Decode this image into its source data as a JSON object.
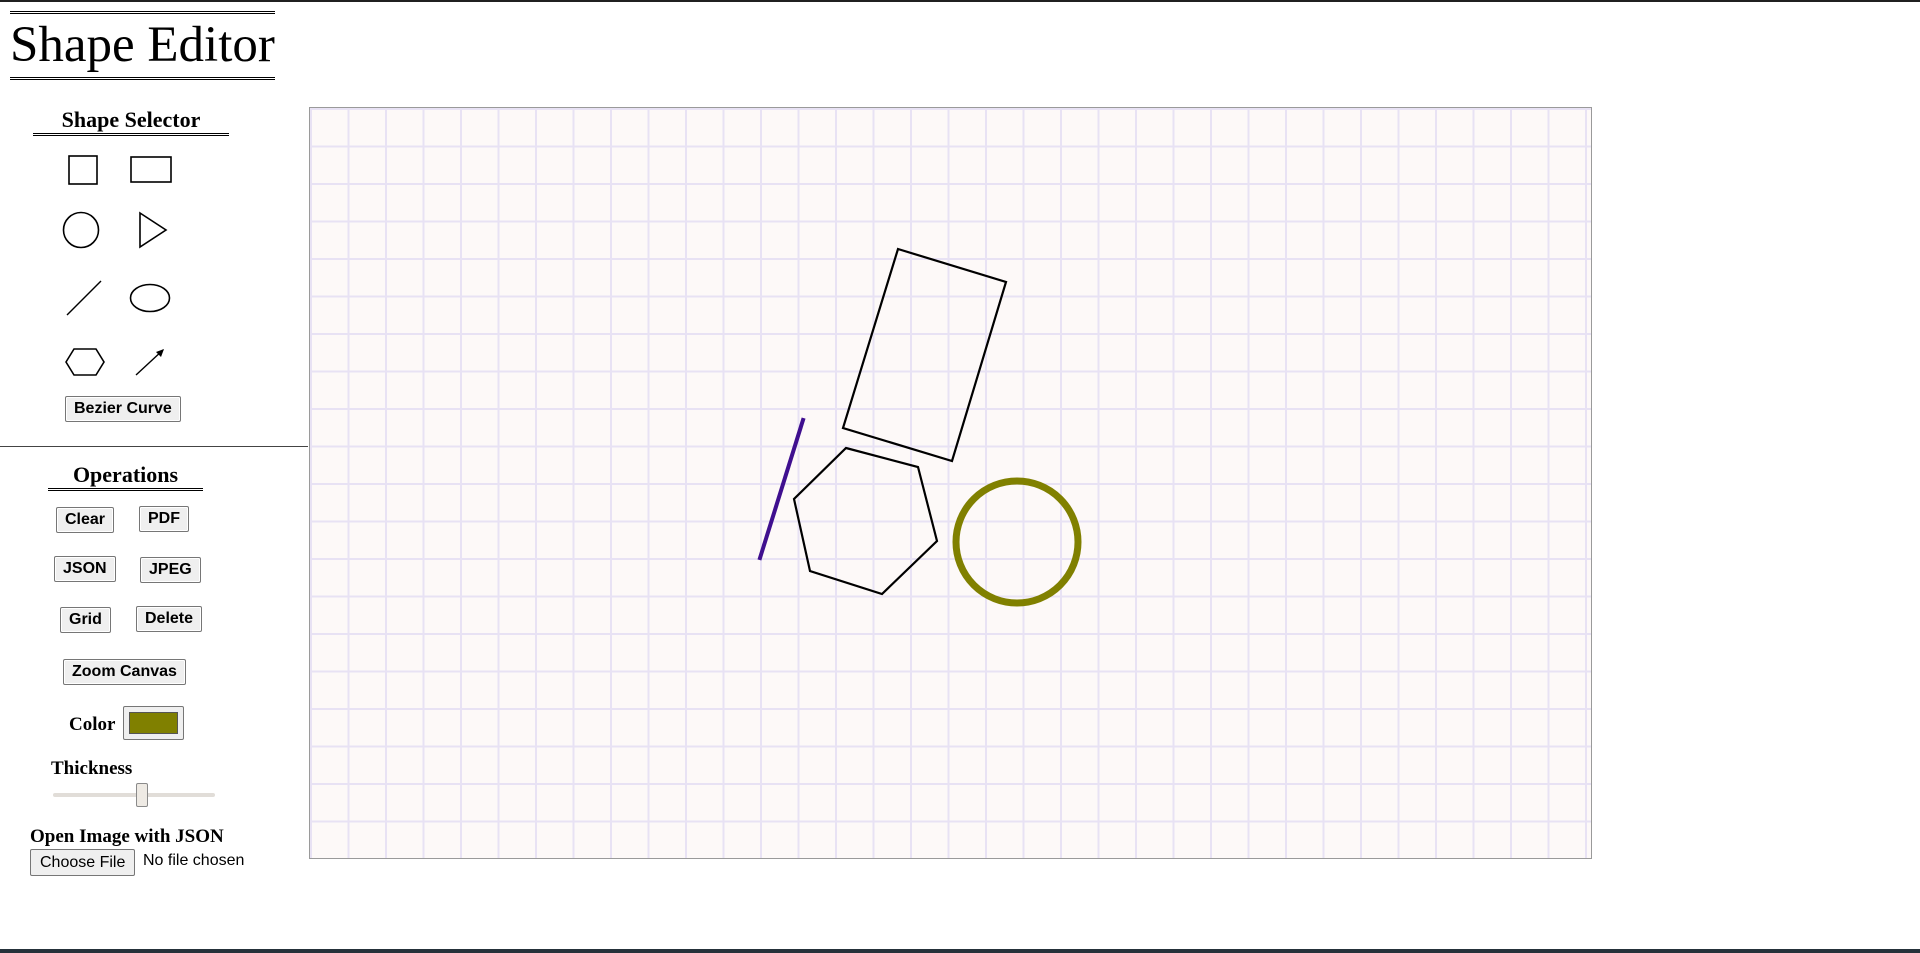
{
  "app": {
    "title": "Shape Editor"
  },
  "shape_selector": {
    "title": "Shape Selector",
    "shapes": [
      {
        "name": "square",
        "icon": "square-icon"
      },
      {
        "name": "rectangle",
        "icon": "rectangle-icon"
      },
      {
        "name": "circle",
        "icon": "circle-icon"
      },
      {
        "name": "triangle",
        "icon": "triangle-icon"
      },
      {
        "name": "line",
        "icon": "line-icon"
      },
      {
        "name": "ellipse",
        "icon": "ellipse-icon"
      },
      {
        "name": "hexagon",
        "icon": "hexagon-icon"
      },
      {
        "name": "arrow",
        "icon": "arrow-icon"
      }
    ],
    "bezier_label": "Bezier Curve"
  },
  "operations": {
    "title": "Operations",
    "clear_label": "Clear",
    "pdf_label": "PDF",
    "json_label": "JSON",
    "jpeg_label": "JPEG",
    "grid_label": "Grid",
    "delete_label": "Delete",
    "zoom_label": "Zoom Canvas",
    "color_label": "Color",
    "color_value": "#808000",
    "thickness_label": "Thickness",
    "thickness_fraction": 0.55
  },
  "open_json": {
    "label": "Open Image with JSON",
    "choose_file_label": "Choose File",
    "file_status": "No file chosen"
  },
  "canvas": {
    "background": "#fdf9f8",
    "grid_color": "#e8e2f4",
    "shapes": [
      {
        "type": "rotated-rectangle",
        "stroke": "#000000"
      },
      {
        "type": "line",
        "stroke": "#3f0f8f"
      },
      {
        "type": "hexagon",
        "stroke": "#000000"
      },
      {
        "type": "circle",
        "stroke": "#808000"
      }
    ]
  }
}
